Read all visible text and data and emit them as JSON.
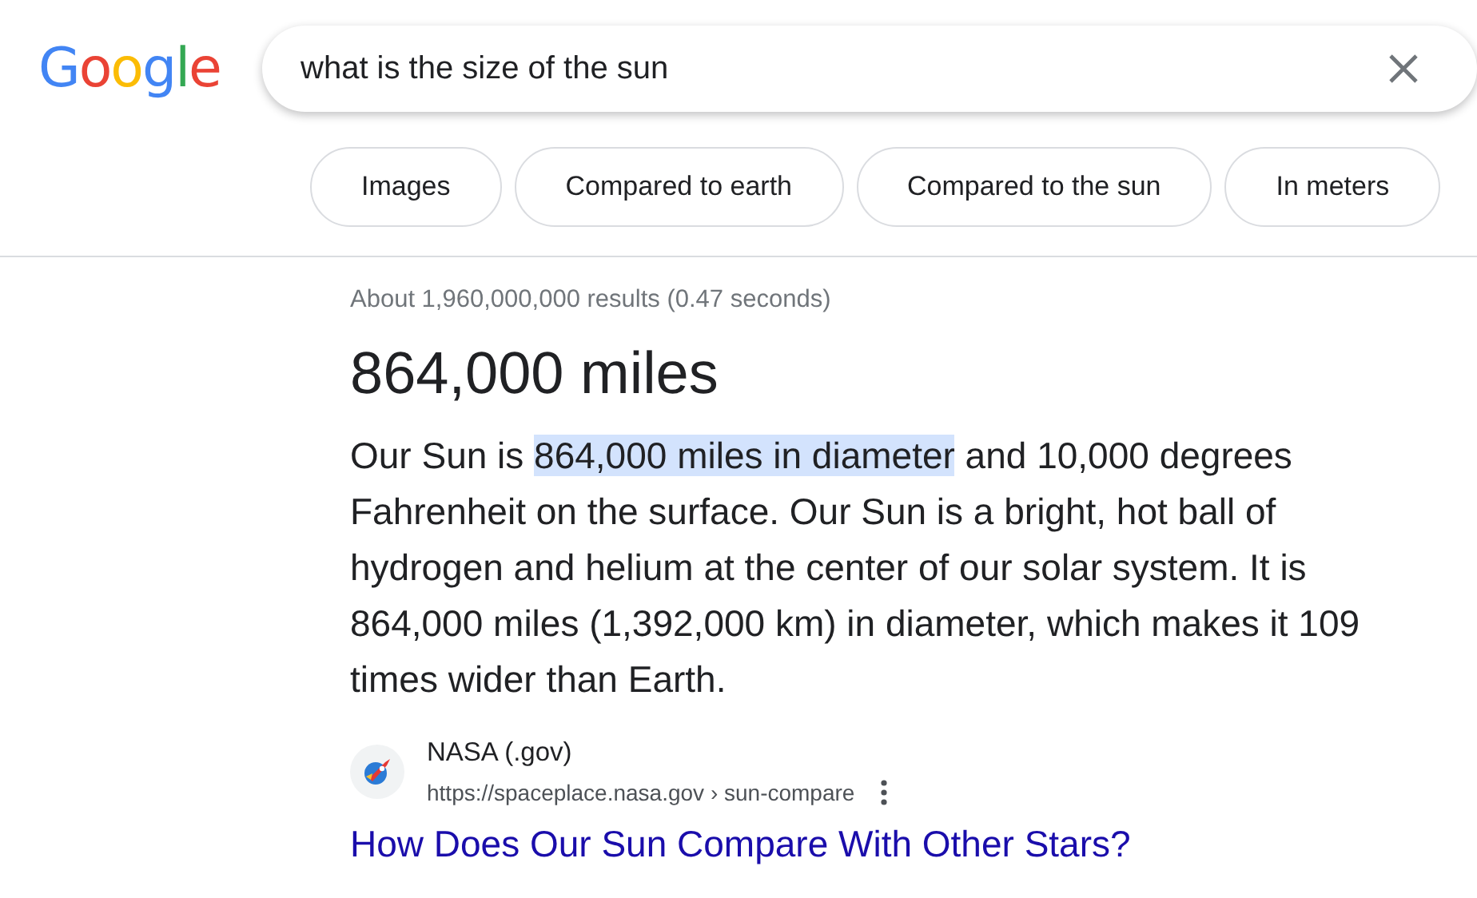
{
  "logo": "Google",
  "search": {
    "value": "what is the size of the sun"
  },
  "chips": [
    {
      "label": "Images"
    },
    {
      "label": "Compared to earth"
    },
    {
      "label": "Compared to the sun"
    },
    {
      "label": "In meters"
    }
  ],
  "result_stats": "About 1,960,000,000 results (0.47 seconds)",
  "answer": {
    "title": "864,000 miles",
    "before": "Our Sun is ",
    "highlighted": "864,000 miles in diameter",
    "after": " and 10,000 degrees Fahrenheit on the surface. Our Sun is a bright, hot ball of hydrogen and helium at the center of our solar system. It is 864,000 miles (1,392,000 km) in diameter, which makes it 109 times wider than Earth."
  },
  "source": {
    "site": "NASA (.gov)",
    "url": "https://spaceplace.nasa.gov › sun-compare",
    "link": "How Does Our Sun Compare With Other Stars?"
  }
}
